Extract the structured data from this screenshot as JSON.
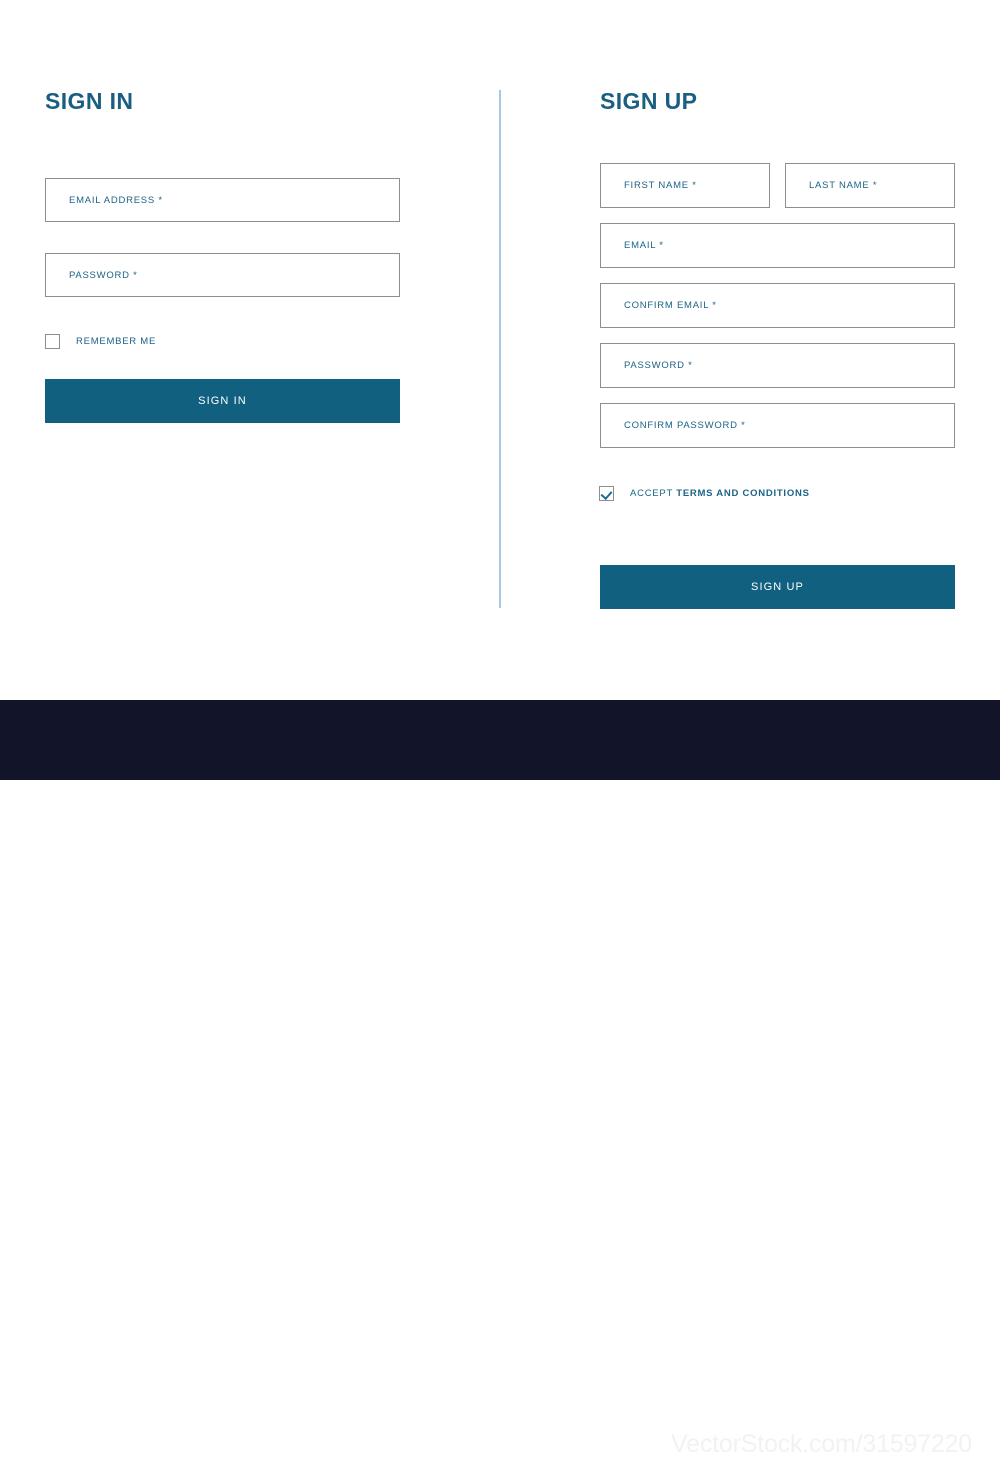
{
  "accent_color": "#11607f",
  "heading_color": "#1a5f82",
  "label_color": "#1c6387",
  "border_color": "#8e8e8e",
  "divider_color": "#a3cbdd",
  "footer_color": "#12142a",
  "sign_in": {
    "heading": "SIGN IN",
    "fields": [
      {
        "name": "email-address",
        "placeholder": "EMAIL ADDRESS *"
      },
      {
        "name": "password",
        "placeholder": "PASSWORD *"
      }
    ],
    "remember_me": {
      "label": "REMEMBER ME",
      "checked": false
    },
    "submit_label": "SIGN IN"
  },
  "sign_up": {
    "heading": "SIGN UP",
    "fields": [
      {
        "name": "first-name",
        "placeholder": "FIRST NAME *"
      },
      {
        "name": "last-name",
        "placeholder": "LAST NAME *"
      },
      {
        "name": "email",
        "placeholder": "EMAIL *"
      },
      {
        "name": "confirm-email",
        "placeholder": "CONFIRM EMAIL *"
      },
      {
        "name": "password",
        "placeholder": "PASSWORD *"
      },
      {
        "name": "confirm-password",
        "placeholder": "CONFIRM PASSWORD *"
      }
    ],
    "terms": {
      "prefix": "ACCEPT",
      "link": "TERMS AND CONDITIONS",
      "checked": true
    },
    "submit_label": "SIGN UP"
  },
  "watermark": {
    "brand_light": "Vector",
    "brand_bold": "Stock",
    "registered": "®",
    "url": "VectorStock.com/31597220"
  }
}
